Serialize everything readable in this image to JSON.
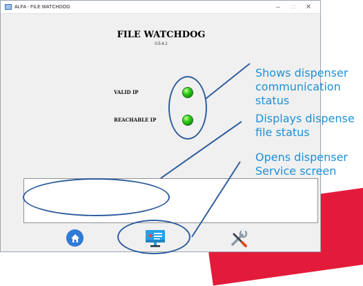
{
  "window": {
    "title": "ALFA - FILE WATCHDOG",
    "minimize": "–",
    "maximize": "□",
    "close": "✕"
  },
  "app": {
    "title": "FILE WATCHDOG",
    "version": "0.5.4.1"
  },
  "status": {
    "valid_ip_label": "VALID IP",
    "reachable_ip_label": "REACHABLE IP",
    "valid_ip_color": "#2ec41a",
    "reachable_ip_color": "#2ec41a"
  },
  "file_status_text": "",
  "nav": {
    "home_icon": "home-icon",
    "service_icon": "service-monitor-icon",
    "tools_icon": "tools-icon"
  },
  "annotations": {
    "communication": [
      "Shows dispenser",
      "communication",
      "status"
    ],
    "file_status": [
      "Displays dispense",
      "file status"
    ],
    "service": [
      "Opens dispenser",
      "Service screen"
    ],
    "color": "#1e90d7"
  }
}
